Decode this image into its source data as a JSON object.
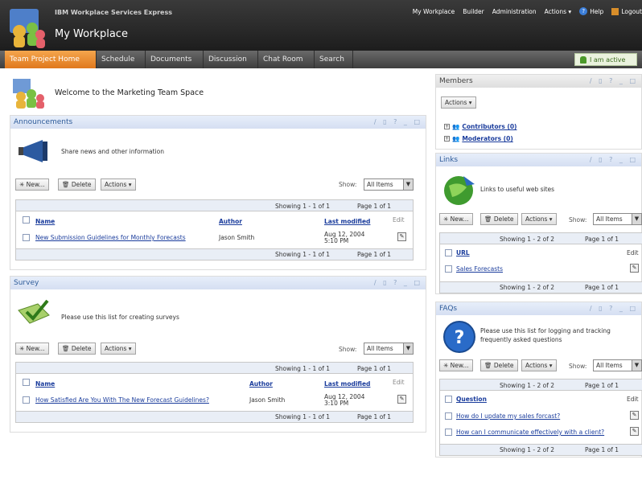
{
  "header": {
    "product": "IBM Workplace Services Express",
    "title": "My Workplace",
    "nav": [
      "My Workplace",
      "Builder",
      "Administration",
      "Actions ▾",
      "Help",
      "Logout"
    ]
  },
  "tabs": [
    "Team Project Home",
    "Schedule",
    "Documents",
    "Discussion",
    "Chat Room",
    "Search"
  ],
  "status": "I am active",
  "welcome": "Welcome to the Marketing Team Space",
  "common": {
    "new": "New...",
    "delete": "Delete",
    "actions": "Actions ▾",
    "show": "Show:",
    "all_items": "All Items",
    "edit": "Edit"
  },
  "announcements": {
    "title": "Announcements",
    "desc": "Share news and other information",
    "paging": "Showing 1 - 1 of 1",
    "page": "Page 1 of 1",
    "cols": {
      "name": "Name",
      "author": "Author",
      "modified": "Last modified"
    },
    "row": {
      "name": "New Submission Guidelines for Monthly Forecasts",
      "author": "Jason Smith",
      "date": "Aug 12, 2004",
      "time": "5:10 PM"
    }
  },
  "survey": {
    "title": "Survey",
    "desc": "Please use this list for creating surveys",
    "paging": "Showing 1 - 1 of 1",
    "page": "Page 1 of 1",
    "cols": {
      "name": "Name",
      "author": "Author",
      "modified": "Last modified"
    },
    "row": {
      "name": "How Satisfied Are You With The New Forecast Guidelines?",
      "author": "Jason Smith",
      "date": "Aug 12, 2004",
      "time": "3:10 PM"
    }
  },
  "members": {
    "title": "Members",
    "actions": "Actions ▾",
    "contributors": "Contributors (0)",
    "moderators": "Moderators (0)"
  },
  "links": {
    "title": "Links",
    "desc": "Links to useful web sites",
    "paging": "Showing 1 - 2 of 2",
    "page": "Page 1 of 1",
    "col": "URL",
    "row": "Sales Forecasts"
  },
  "faqs": {
    "title": "FAQs",
    "desc": "Please use this list for logging and tracking frequently asked questions",
    "paging": "Showing 1 - 2 of 2",
    "page": "Page 1 of 1",
    "col": "Question",
    "rows": [
      "How do I update my sales forcast?",
      "How can I communicate effectively with a client?"
    ]
  },
  "panel_controls": "∕ ▯ ? _ □"
}
